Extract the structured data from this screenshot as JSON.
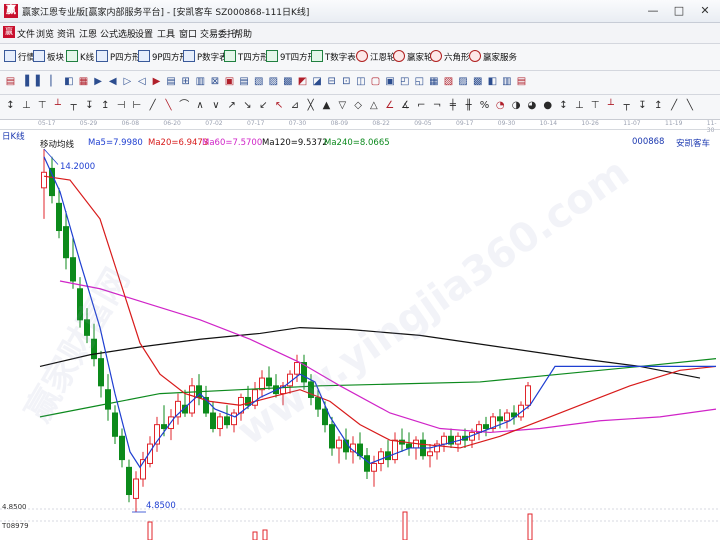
{
  "window": {
    "title": "赢家江恩专业版[赢家内部服务平台] - [安凯客车  SZ000868-111日K线]",
    "controls": [
      "—",
      "□",
      "✕"
    ]
  },
  "menu": {
    "items": [
      "文件",
      "浏览",
      "资讯",
      "江恩",
      "公式选股",
      "设置",
      "工具",
      "窗口",
      "交易委托",
      "帮助"
    ]
  },
  "toolbar": {
    "buttons": [
      "行情",
      "板块",
      "K线",
      "P四方形",
      "9P四方形",
      "P数字表",
      "T四方形",
      "9T四方形",
      "T数字表",
      "江恩轮",
      "赢家轮",
      "六角形",
      "赢家服务"
    ]
  },
  "chart": {
    "period_label": "日K线",
    "indicator_title": "移动均线",
    "ma_labels": [
      "Ma5=7.9980",
      "Ma20=6.9473",
      "Ma60=7.5700",
      "Ma120=9.5372",
      "Ma240=8.0665"
    ],
    "ma_colors": [
      "#1f3fd1",
      "#d81b1b",
      "#d024c8",
      "#111111",
      "#0d8a1e"
    ],
    "stock_code": "000868",
    "stock_name": "安凯客车",
    "high_mark": "14.2000",
    "low_mark": "4.8500",
    "axis_low": "4.8500",
    "volume_label": "T08979",
    "dates": [
      "05-17",
      "05-29",
      "06-08",
      "06-20",
      "07-02",
      "07-17",
      "07-30",
      "08-09",
      "08-22",
      "09-05",
      "09-17",
      "09-30",
      "10-14",
      "10-26",
      "11-07",
      "11-19",
      "11-30"
    ],
    "watermark": "赢家财富网",
    "watermark_url": "www.yingjia360.com",
    "up_color": "#e0252b",
    "down_color": "#0c8a1b"
  },
  "chart_data": {
    "type": "candlestick",
    "title": "移动均线",
    "stock": "安凯客车 000868",
    "period": "日K线",
    "ylim": [
      4.85,
      14.2
    ],
    "high": 14.2,
    "low": 4.85,
    "series": [
      {
        "name": "Ma5",
        "last": 7.998
      },
      {
        "name": "Ma20",
        "last": 6.9473
      },
      {
        "name": "Ma60",
        "last": 7.57
      },
      {
        "name": "Ma120",
        "last": 9.5372
      },
      {
        "name": "Ma240",
        "last": 8.0665
      }
    ]
  }
}
